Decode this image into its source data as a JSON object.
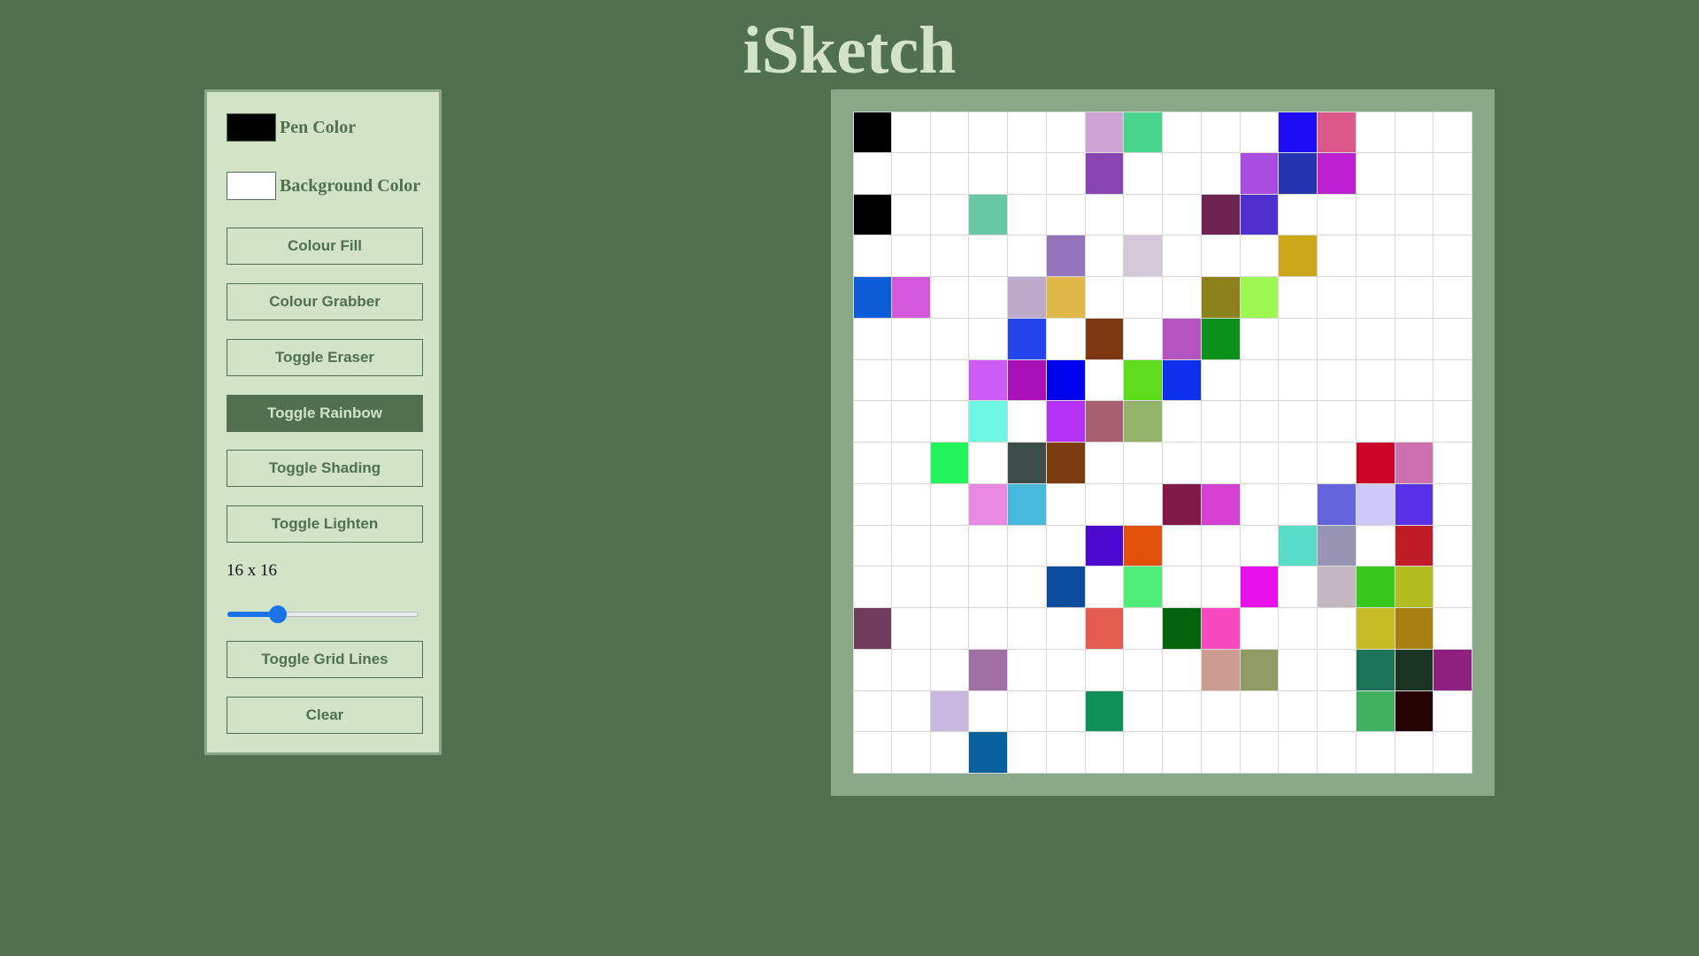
{
  "app": {
    "title": "iSketch"
  },
  "controls": {
    "pen_color_label": "Pen Color",
    "pen_color": "#000000",
    "background_color_label": "Background Color",
    "background_color": "#ffffff",
    "buttons": [
      {
        "id": "colour-fill",
        "label": "Colour Fill",
        "active": false
      },
      {
        "id": "colour-grabber",
        "label": "Colour Grabber",
        "active": false
      },
      {
        "id": "toggle-eraser",
        "label": "Toggle Eraser",
        "active": false
      },
      {
        "id": "toggle-rainbow",
        "label": "Toggle Rainbow",
        "active": true
      },
      {
        "id": "toggle-shading",
        "label": "Toggle Shading",
        "active": false
      },
      {
        "id": "toggle-lighten",
        "label": "Toggle Lighten",
        "active": false
      },
      {
        "id": "toggle-grid-lines",
        "label": "Toggle Grid Lines",
        "active": false
      },
      {
        "id": "clear",
        "label": "Clear",
        "active": false
      }
    ],
    "grid_size_label": "16 x 16",
    "slider": {
      "min": 1,
      "max": 64,
      "value": 16
    }
  },
  "theme": {
    "background": "#507050",
    "panel": "#d3e3c8",
    "accent": "#88a888",
    "slider_accent": "#1a73e8"
  },
  "canvas": {
    "rows": 16,
    "cols": 16,
    "cells": [
      [
        "#000000",
        null,
        null,
        null,
        null,
        null,
        "#cda4d4",
        "#48d48c",
        null,
        null,
        null,
        "#1e0cf4",
        "#dc5888",
        null,
        null,
        null
      ],
      [
        null,
        null,
        null,
        null,
        null,
        null,
        "#8844b0",
        null,
        null,
        null,
        "#a84ce0",
        "#2434b0",
        "#bc20d0",
        null,
        null,
        null
      ],
      [
        "#000000",
        null,
        null,
        "#68c8a4",
        null,
        null,
        null,
        null,
        null,
        "#6c2450",
        "#5030cc",
        null,
        null,
        null,
        null,
        null
      ],
      [
        null,
        null,
        null,
        null,
        null,
        "#9474bc",
        null,
        "#d2c8d8",
        null,
        null,
        null,
        "#cca818",
        null,
        null,
        null,
        null
      ],
      [
        "#0c5cd8",
        "#d458dc",
        null,
        null,
        "#bcaac8",
        "#e0b848",
        null,
        null,
        null,
        "#8c801c",
        "#9cf850",
        null,
        null,
        null,
        null,
        null
      ],
      [
        null,
        null,
        null,
        null,
        "#2444ec",
        null,
        "#7c3810",
        null,
        "#b454c0",
        "#0c901c",
        null,
        null,
        null,
        null,
        null,
        null
      ],
      [
        null,
        null,
        null,
        "#cc5cf4",
        "#a810b8",
        "#0004ec",
        null,
        "#5cdc1c",
        "#0c30ec",
        null,
        null,
        null,
        null,
        null,
        null,
        null
      ],
      [
        null,
        null,
        null,
        "#6cf8e4",
        null,
        "#b430f4",
        "#a86070",
        "#94b46c",
        null,
        null,
        null,
        null,
        null,
        null,
        null,
        null
      ],
      [
        null,
        null,
        "#24f45c",
        null,
        "#3c4c48",
        "#7c3c10",
        null,
        null,
        null,
        null,
        null,
        null,
        null,
        "#cc0428",
        "#cc70b0",
        null
      ],
      [
        null,
        null,
        null,
        "#e888e0",
        "#48b8dc",
        null,
        null,
        null,
        "#801848",
        "#d440d0",
        null,
        null,
        "#6464dc",
        "#ccc8f8",
        "#5830e8",
        null
      ],
      [
        null,
        null,
        null,
        null,
        null,
        null,
        "#4c08cc",
        "#e05008",
        null,
        null,
        null,
        "#58dcc8",
        "#9894b4",
        null,
        "#c01c28",
        null
      ],
      [
        null,
        null,
        null,
        null,
        null,
        "#0c4c9c",
        null,
        "#50ec78",
        null,
        null,
        "#e810e8",
        null,
        "#c4b8c0",
        "#38c81c",
        "#b0bc20",
        null
      ],
      [
        "#703c5c",
        null,
        null,
        null,
        null,
        null,
        "#e45c50",
        null,
        "#04640c",
        "#f848c0",
        null,
        null,
        null,
        "#c8bc24",
        "#a88010",
        null
      ],
      [
        null,
        null,
        null,
        "#a070a4",
        null,
        null,
        null,
        null,
        null,
        "#cc9c90",
        "#8c9c64",
        null,
        null,
        "#1c7458",
        "#1c3424",
        "#902080"
      ],
      [
        null,
        null,
        "#c8b8e0",
        null,
        null,
        null,
        "#109058",
        null,
        null,
        null,
        null,
        null,
        null,
        "#40b060",
        "#240404",
        null
      ],
      [
        null,
        null,
        null,
        "#08609c",
        null,
        null,
        null,
        null,
        null,
        null,
        null,
        null,
        null,
        null,
        null,
        null
      ]
    ]
  }
}
